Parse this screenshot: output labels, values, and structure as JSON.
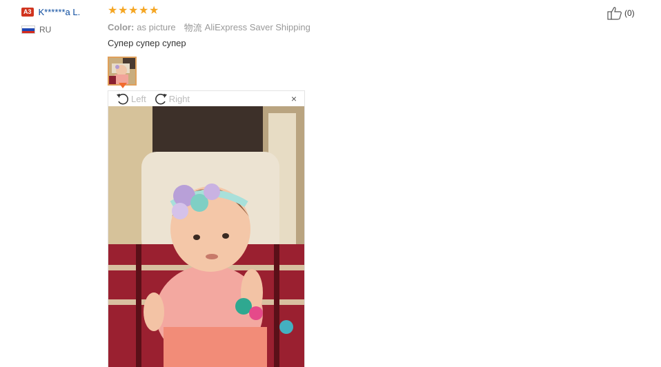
{
  "reviewer": {
    "level_badge": "A3",
    "name": "K******a L.",
    "country_code": "RU",
    "flag_colors": [
      "#ffffff",
      "#1f48b4",
      "#d52b1e"
    ]
  },
  "review": {
    "rating": 5,
    "rating_max": 5,
    "color_label": "Color:",
    "color_value": "as picture",
    "shipping_label": "物流",
    "shipping_value": "AliExpress Saver Shipping",
    "text": "Супер супер супер"
  },
  "viewer": {
    "rotate_left_label": "Left",
    "rotate_right_label": "Right",
    "close_label": "×"
  },
  "like": {
    "count_text": "(0)",
    "icon": "thumbs-up-icon"
  },
  "colors": {
    "star": "#f5a623",
    "link": "#0a4a9e",
    "badge": "#d0341f",
    "thumb_border": "#e0a05a",
    "pointer": "#f16a2f"
  }
}
